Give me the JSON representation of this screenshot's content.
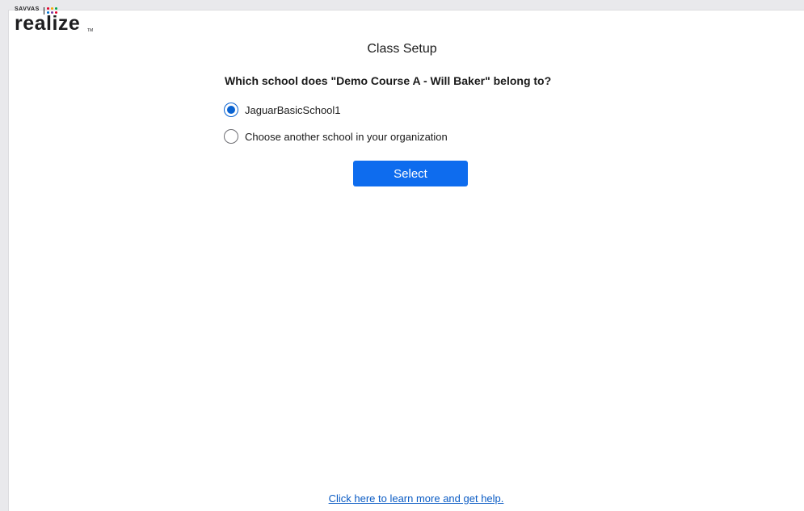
{
  "logo": {
    "brand_small": "SAVVAS",
    "brand_word": "realize",
    "tm": "TM",
    "dot_colors": [
      "#e4002b",
      "#f5a800",
      "#00a651",
      "#0072ce",
      "#7a3e9d",
      "#e4002b"
    ]
  },
  "page": {
    "title": "Class Setup",
    "question": "Which school does \"Demo Course A - Will Baker\" belong to?"
  },
  "options": [
    {
      "label": "JaguarBasicSchool1",
      "checked": true
    },
    {
      "label": "Choose another school in your organization",
      "checked": false
    }
  ],
  "actions": {
    "select_label": "Select"
  },
  "footer": {
    "help_link": "Click here to learn more and get help."
  },
  "colors": {
    "accent": "#0e6cee",
    "radio_checked": "#0a63d1",
    "link": "#0a5bc4"
  }
}
